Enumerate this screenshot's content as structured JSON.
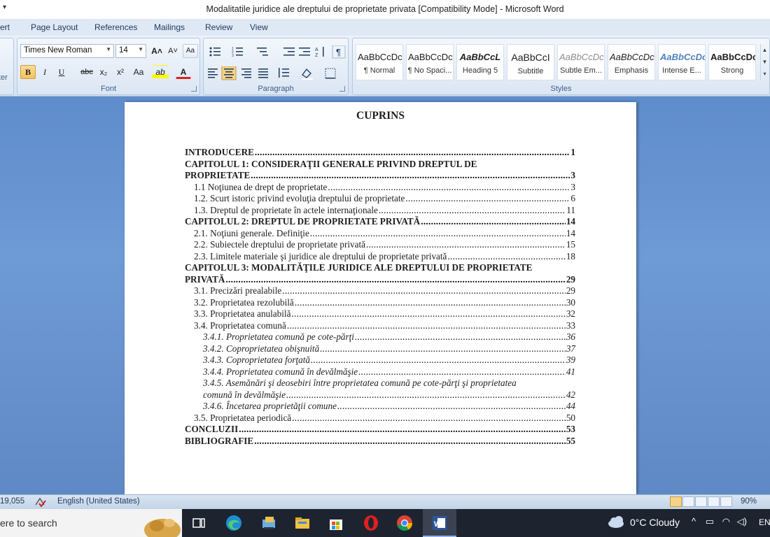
{
  "window": {
    "title": "Modalitatile juridice ale dreptului de proprietate privata [Compatibility Mode] - Microsoft Word",
    "qat_arrow": "▾"
  },
  "ribbon_tabs": [
    "ert",
    "Page Layout",
    "References",
    "Mailings",
    "Review",
    "View"
  ],
  "ribbon": {
    "left_group_label": "ter",
    "font": {
      "name": "Times New Roman",
      "size": "14",
      "grow": "A˄",
      "shrink": "A˅",
      "clear": "Aa",
      "bold": "B",
      "italic": "I",
      "underline": "U",
      "strike": "abc",
      "subscript": "x₂",
      "superscript": "x²",
      "change_case": "Aa",
      "highlight": "ab",
      "font_color": "A",
      "group_label": "Font"
    },
    "paragraph": {
      "group_label": "Paragraph",
      "show_marks": "¶"
    },
    "styles": {
      "group_label": "Styles",
      "items": [
        {
          "sample": "AaBbCcDc",
          "name": "¶ Normal"
        },
        {
          "sample": "AaBbCcDc",
          "name": "¶ No Spaci..."
        },
        {
          "sample": "AaBbCcL",
          "name": "Heading 5"
        },
        {
          "sample": "AaBbCcI",
          "name": "Subtitle"
        },
        {
          "sample": "AaBbCcDc",
          "name": "Subtle Em..."
        },
        {
          "sample": "AaBbCcDc",
          "name": "Emphasis"
        },
        {
          "sample": "AaBbCcDc",
          "name": "Intense E..."
        },
        {
          "sample": "AaBbCcDc",
          "name": "Strong"
        }
      ]
    }
  },
  "document": {
    "title": "CUPRINS",
    "entries": [
      {
        "text": "INTRODUCERE",
        "page": "1",
        "style": "bold",
        "level": 0
      },
      {
        "text_line1": "CAPITOLUL 1: CONSIDERAŢII  GENERALE  PRIVIND  DREPTUL  DE",
        "text": "PROPRIETATE",
        "page": "3",
        "style": "bold",
        "level": 0
      },
      {
        "text": "1.1 Noţiunea de drept de proprietate",
        "page": "3",
        "style": "normal",
        "level": 1
      },
      {
        "text": "1.2. Scurt istoric privind evoluţia dreptului de proprietate",
        "page": "6",
        "style": "normal",
        "level": 1
      },
      {
        "text": "1.3. Dreptul de proprietate în actele internaţionale",
        "page": "11",
        "style": "normal",
        "level": 1
      },
      {
        "text": "CAPITOLUL 2: DREPTUL DE PROPRIETATE PRIVATĂ",
        "page": "14",
        "style": "bold",
        "level": 0
      },
      {
        "text": "2.1. Noţiuni generale. Definiţie",
        "page": "14",
        "style": "normal",
        "level": 1
      },
      {
        "text": "2.2. Subiectele dreptului de proprietate privată",
        "page": "15",
        "style": "normal",
        "level": 1
      },
      {
        "text": "2.3. Limitele materiale şi juridice ale dreptului de proprietate privată",
        "page": "18",
        "style": "normal",
        "level": 1
      },
      {
        "text_line1": "CAPITOLUL 3: MODALITĂŢILE  JURIDICE  ALE  DREPTULUI  DE  PROPRIETATE",
        "text": "PRIVATĂ",
        "page": "29",
        "style": "bold",
        "level": 0
      },
      {
        "text": "3.1. Precizări prealabile",
        "page": "29",
        "style": "normal",
        "level": 1
      },
      {
        "text": "3.2. Proprietatea rezolubilă",
        "page": "30",
        "style": "normal",
        "level": 1
      },
      {
        "text": "3.3. Proprietatea anulabilă",
        "page": "32",
        "style": "normal",
        "level": 1
      },
      {
        "text": "3.4. Proprietatea comună",
        "page": "33",
        "style": "normal",
        "level": 1
      },
      {
        "text": "3.4.1. Proprietatea comună pe cote-părţi",
        "page": "36",
        "style": "italic",
        "level": 2
      },
      {
        "text": "3.4.2. Coproprietatea obişnuită",
        "page": "37",
        "style": "italic",
        "level": 2
      },
      {
        "text": "3.4.3. Coproprietatea forţată",
        "page": "39",
        "style": "italic",
        "level": 2
      },
      {
        "text": "3.4.4. Proprietatea comună în devălmăşie",
        "page": "41",
        "style": "italic",
        "level": 2
      },
      {
        "text_line1": "3.4.5. Asemănări şi deosebiri între proprietatea  comună pe cote-părţi şi proprietatea",
        "text": "comună în devălmăşie",
        "page": "42",
        "style": "italic",
        "level": 2
      },
      {
        "text": "3.4.6. Încetarea proprietăţii comune",
        "page": "44",
        "style": "italic",
        "level": 2
      },
      {
        "text": "3.5. Proprietatea periodică",
        "page": "50",
        "style": "normal",
        "level": 1
      },
      {
        "text": "CONCLUZII",
        "page": "53",
        "style": "bold",
        "level": 0
      },
      {
        "text": "BIBLIOGRAFIE",
        "page": "55",
        "style": "bold",
        "level": 0
      }
    ]
  },
  "statusbar": {
    "word_count": "19,055",
    "language": "English (United States)",
    "zoom": "90%"
  },
  "taskbar": {
    "search_placeholder": "ere to search",
    "weather": "0°C  Cloudy",
    "language": "EN",
    "apps": [
      "task-view",
      "edge",
      "file-manager",
      "file-explorer",
      "store",
      "opera",
      "chrome",
      "word"
    ]
  },
  "colors": {
    "doc_background": "#6e9ad6",
    "ribbon_tab_text": "#1e395b",
    "taskbar": "#1d2430"
  }
}
